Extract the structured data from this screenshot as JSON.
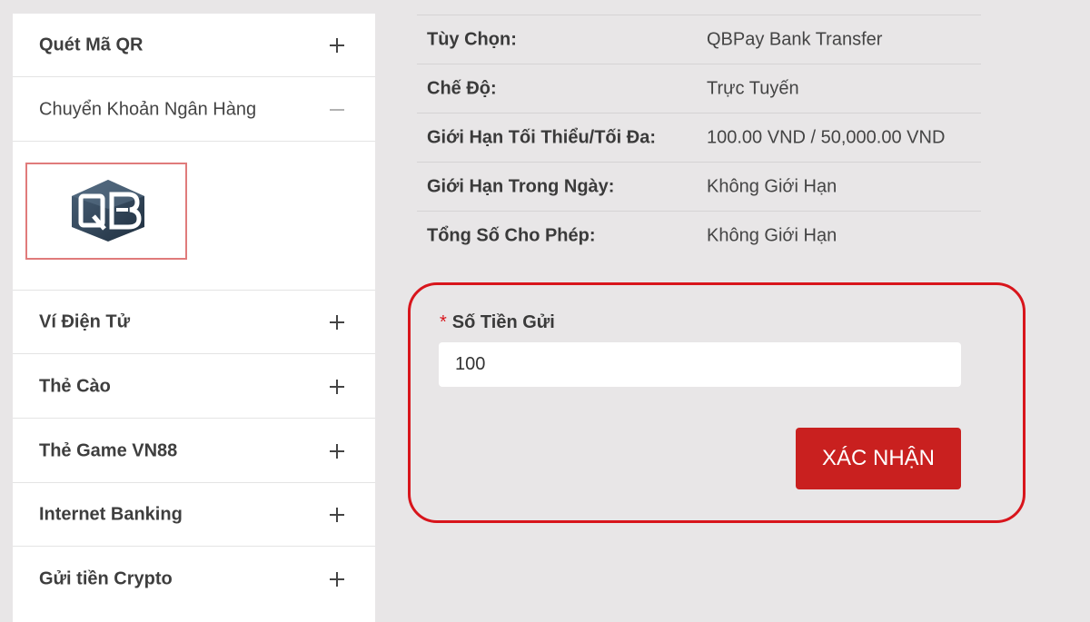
{
  "menu": {
    "items": [
      {
        "label": "Quét Mã QR",
        "toggle": "+"
      },
      {
        "label": "Chuyển Khoản Ngân Hàng",
        "toggle": "−",
        "expanded": true,
        "bank_logo_text": "QB"
      },
      {
        "label": "Ví Điện Tử",
        "toggle": "+"
      },
      {
        "label": "Thẻ Cào",
        "toggle": "+"
      },
      {
        "label": "Thẻ Game VN88",
        "toggle": "+"
      },
      {
        "label": "Internet Banking",
        "toggle": "+"
      },
      {
        "label": "Gửi tiền Crypto",
        "toggle": "+"
      }
    ]
  },
  "info": {
    "rows": [
      {
        "key": "Tùy Chọn:",
        "value": "QBPay Bank Transfer"
      },
      {
        "key": "Chế Độ:",
        "value": "Trực Tuyến"
      },
      {
        "key": "Giới Hạn Tối Thiểu/Tối Đa:",
        "value": "100.00 VND / 50,000.00 VND"
      },
      {
        "key": "Giới Hạn Trong Ngày:",
        "value": "Không Giới Hạn"
      },
      {
        "key": "Tổng Số Cho Phép:",
        "value": "Không Giới Hạn"
      }
    ]
  },
  "deposit": {
    "required_mark": "*",
    "label": "Số Tiền Gửi",
    "amount": "100",
    "confirm_label": "XÁC NHẬN"
  },
  "colors": {
    "accent_red": "#c9201f",
    "highlight_border": "#d8151c",
    "page_bg": "#e8e6e7",
    "logo_dark": "#26384a"
  }
}
